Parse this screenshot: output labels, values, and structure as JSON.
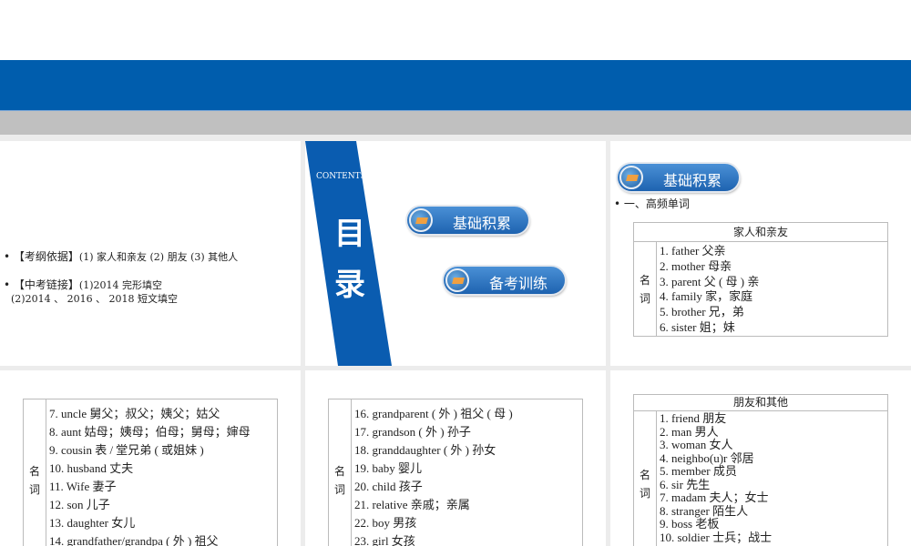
{
  "header": {
    "brand_color": "#005dad"
  },
  "slide1": {
    "bullets": [
      {
        "label": "【考纲依据】",
        "text": "(1) 家人和亲友  (2) 朋友  (3) 其他人"
      },
      {
        "label": "【中考链接】",
        "text": "(1)2014 完形填空",
        "text2": "(2)2014 、 2016 、 2018 短文填空"
      }
    ]
  },
  "slide2": {
    "contents": "CONTENTS",
    "title1": "目",
    "title2": "录",
    "buttons": [
      "基础积累",
      "备考训练"
    ]
  },
  "slide3": {
    "button": "基础积累",
    "section": "• 一、高频单词",
    "table_title": "家人和亲友",
    "label": "名词",
    "items": [
      "1. father 父亲",
      "2. mother 母亲",
      "3. parent 父 ( 母 ) 亲",
      "4. family 家，家庭",
      "5. brother 兄，弟",
      "6. sister 姐；妹"
    ]
  },
  "slide4": {
    "label": "名词",
    "items": [
      "7. uncle  舅父；叔父；姨父；姑父",
      "8. aunt  姑母；姨母；伯母；舅母；婶母",
      "9. cousin  表 / 堂兄弟 ( 或姐妹 )",
      "10. husband  丈夫",
      "11. Wife  妻子",
      "12. son  儿子",
      "13. daughter 女儿",
      "14. grandfather/grandpa ( 外 ) 祖父"
    ]
  },
  "slide5": {
    "label": "名词",
    "items": [
      "16. grandparent ( 外 ) 祖父 ( 母 )",
      "17. grandson ( 外 ) 孙子",
      "18. granddaughter ( 外 ) 孙女",
      "19. baby  婴儿",
      "20. child  孩子",
      "21. relative  亲戚；亲属",
      "22. boy  男孩",
      "23. girl  女孩"
    ]
  },
  "slide6": {
    "table_title": "朋友和其他",
    "label": "名词",
    "items": [
      "1. friend 朋友",
      "2. man 男人",
      "3. woman 女人",
      "4. neighbo(u)r 邻居",
      "5. member 成员",
      "6. sir 先生",
      "7. madam 夫人；女士",
      "8. stranger 陌生人",
      "9. boss 老板",
      "10. soldier 士兵；战士"
    ]
  }
}
